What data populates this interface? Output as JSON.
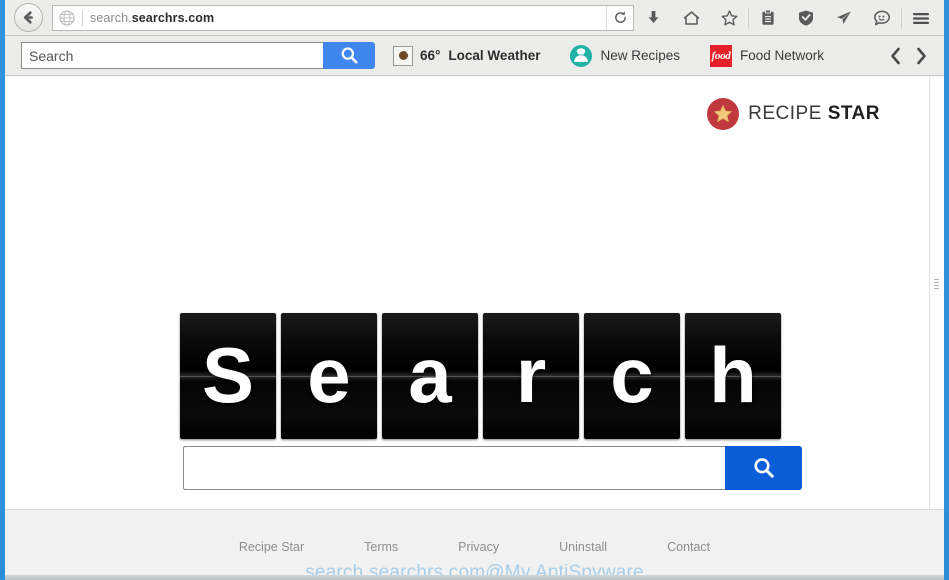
{
  "window": {
    "frame_color": "#2f92dc"
  },
  "browser": {
    "back_label": "Back",
    "url": "search.searchrs.com",
    "url_prefix": "search.",
    "url_domain": "searchrs.com",
    "reload_label": "Reload",
    "toolbar_icons": [
      {
        "name": "download-icon",
        "label": "Downloads"
      },
      {
        "name": "home-icon",
        "label": "Home"
      },
      {
        "name": "star-icon",
        "label": "Bookmarks"
      },
      {
        "name": "clipboard-icon",
        "label": "Reading List"
      },
      {
        "name": "shield-icon",
        "label": "Protection"
      },
      {
        "name": "paper-plane-icon",
        "label": "Send"
      },
      {
        "name": "chat-icon",
        "label": "Messages"
      },
      {
        "name": "hamburger-icon",
        "label": "Menu"
      }
    ]
  },
  "extension_bar": {
    "search_placeholder": "Search",
    "search_value": "",
    "search_button_color": "#3f86ef",
    "items": [
      {
        "icon": "coffee-weather-icon",
        "temperature": "66°",
        "label": "Local Weather"
      },
      {
        "icon": "chef-icon",
        "label": "New Recipes"
      },
      {
        "icon": "food-network-icon",
        "icon_text": "food",
        "label": "Food Network"
      }
    ],
    "prev_label": "‹",
    "next_label": "›"
  },
  "page": {
    "logo": {
      "badge_color": "#c0393f",
      "star_color": "#f2c879",
      "text_light": "RECIPE",
      "text_bold": "STAR"
    },
    "tiles": [
      "S",
      "e",
      "a",
      "r",
      "c",
      "h"
    ],
    "search": {
      "value": "",
      "placeholder": "",
      "button_color": "#0b5ed7",
      "button_icon": "magnifier-icon"
    }
  },
  "footer": {
    "links": [
      "Recipe Star",
      "Terms",
      "Privacy",
      "Uninstall",
      "Contact"
    ],
    "watermark": "search.searchrs.com@My AntiSpyware"
  }
}
